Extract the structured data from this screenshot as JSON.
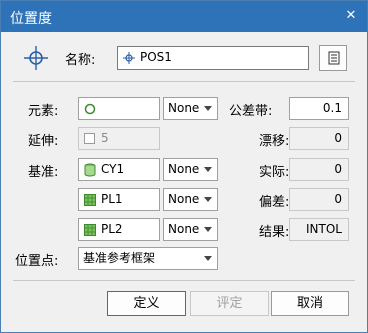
{
  "window": {
    "title": "位置度",
    "close_symbol": "✕"
  },
  "name_row": {
    "label": "名称:",
    "value": "POS1",
    "icons": {
      "main": "position-crosshair-icon",
      "field": "position-small-icon",
      "side_button": "feature-list-icon"
    }
  },
  "left": {
    "element": {
      "label": "元素:",
      "mode": "None",
      "icon": "circle-icon"
    },
    "extend": {
      "label": "延伸:",
      "value": "5",
      "checkbox": "unchecked"
    },
    "datum": {
      "label": "基准:",
      "rows": [
        {
          "name": "CY1",
          "icon": "cylinder-icon",
          "mode": "None"
        },
        {
          "name": "PL1",
          "icon": "plane-icon",
          "mode": "None"
        },
        {
          "name": "PL2",
          "icon": "plane-icon",
          "mode": "None"
        }
      ]
    },
    "position_point": {
      "label": "位置点:",
      "value": "基准参考框架"
    }
  },
  "right": {
    "tolerance": {
      "label": "公差带:",
      "value": "0.1"
    },
    "drift": {
      "label": "漂移:",
      "value": "0"
    },
    "actual": {
      "label": "实际:",
      "value": "0"
    },
    "deviation": {
      "label": "偏差:",
      "value": "0"
    },
    "result": {
      "label": "结果:",
      "value": "INTOL"
    }
  },
  "buttons": {
    "ok": "定义",
    "evaluate": "评定",
    "cancel": "取消"
  },
  "colors": {
    "titlebar": "#2e73b8",
    "dialog_bg": "#f0f0f0",
    "icon_green": "#3a8a2e",
    "icon_blue": "#2a5fa8"
  }
}
